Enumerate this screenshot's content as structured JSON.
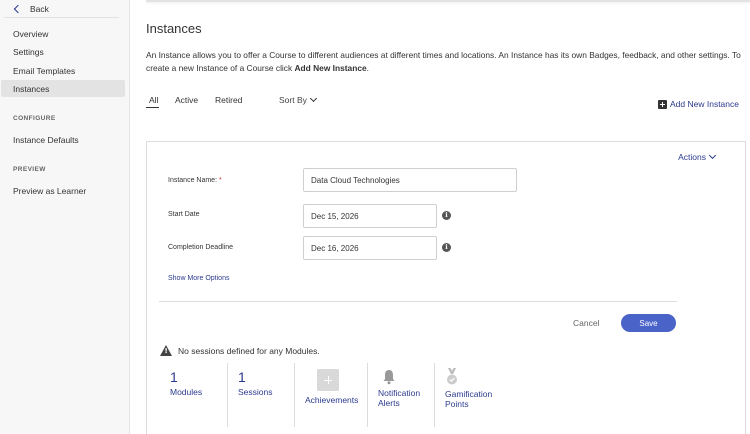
{
  "sidebar": {
    "back_label": "Back",
    "items": [
      {
        "label": "Overview"
      },
      {
        "label": "Settings"
      },
      {
        "label": "Email Templates"
      },
      {
        "label": "Instances"
      }
    ],
    "configure_label": "CONFIGURE",
    "configure_items": [
      {
        "label": "Instance Defaults"
      }
    ],
    "preview_label": "PREVIEW",
    "preview_items": [
      {
        "label": "Preview as Learner"
      }
    ]
  },
  "main": {
    "title": "Instances",
    "description_part1": "An Instance allows you to offer a Course to different audiences at different times and locations. An Instance has its own Badges, feedback, and other settings. To create a new Instance of a Course click ",
    "description_bold": "Add New Instance",
    "description_part2": ".",
    "tabs": [
      {
        "label": "All"
      },
      {
        "label": "Active"
      },
      {
        "label": "Retired"
      }
    ],
    "sort_label": "Sort By",
    "add_new_label": "Add New Instance"
  },
  "card": {
    "actions_label": "Actions",
    "instance_name_label": "Instance Name:",
    "required_mark": "*",
    "instance_name_value": "Data Cloud Technologies",
    "start_date_label": "Start Date",
    "start_date_value": "Dec 15, 2026",
    "completion_label": "Completion Deadline",
    "completion_value": "Dec 16, 2026",
    "show_more_label": "Show More Options",
    "cancel_label": "Cancel",
    "save_label": "Save",
    "warning_text": "No sessions defined for any Modules.",
    "stats": [
      {
        "num": "1",
        "label": "Modules"
      },
      {
        "num": "1",
        "label": "Sessions"
      },
      {
        "label": "Achievements"
      },
      {
        "label_line1": "Notification",
        "label_line2": "Alerts"
      },
      {
        "label_line1": "Gamification",
        "label_line2": "Points"
      }
    ]
  },
  "colors": {
    "accent": "#2b3a8c",
    "save_button": "#4a63c9",
    "sidebar_bg": "#f7f7f7",
    "active_item_bg": "#e3e3e3"
  }
}
